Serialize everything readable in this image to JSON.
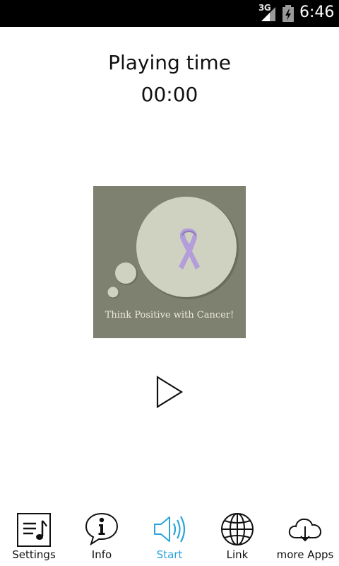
{
  "status_bar": {
    "network": "3G",
    "time": "6:46",
    "icons": [
      "signal-icon",
      "battery-charging-icon"
    ]
  },
  "player": {
    "title": "Playing time",
    "elapsed": "00:00",
    "artwork_caption": "Think Positive with Cancer!",
    "play_icon": "play-icon"
  },
  "nav": {
    "items": [
      {
        "label": "Settings",
        "icon": "settings-playlist-icon"
      },
      {
        "label": "Info",
        "icon": "info-bubble-icon"
      },
      {
        "label": "Start",
        "icon": "speaker-icon",
        "active": true
      },
      {
        "label": "Link",
        "icon": "globe-icon"
      },
      {
        "label": "more Apps",
        "icon": "cloud-download-icon"
      }
    ]
  },
  "colors": {
    "accent": "#29a3db",
    "artwork_bg": "#7e8170",
    "bubble": "#cfd2c0",
    "ribbon": "#b39ddb"
  }
}
